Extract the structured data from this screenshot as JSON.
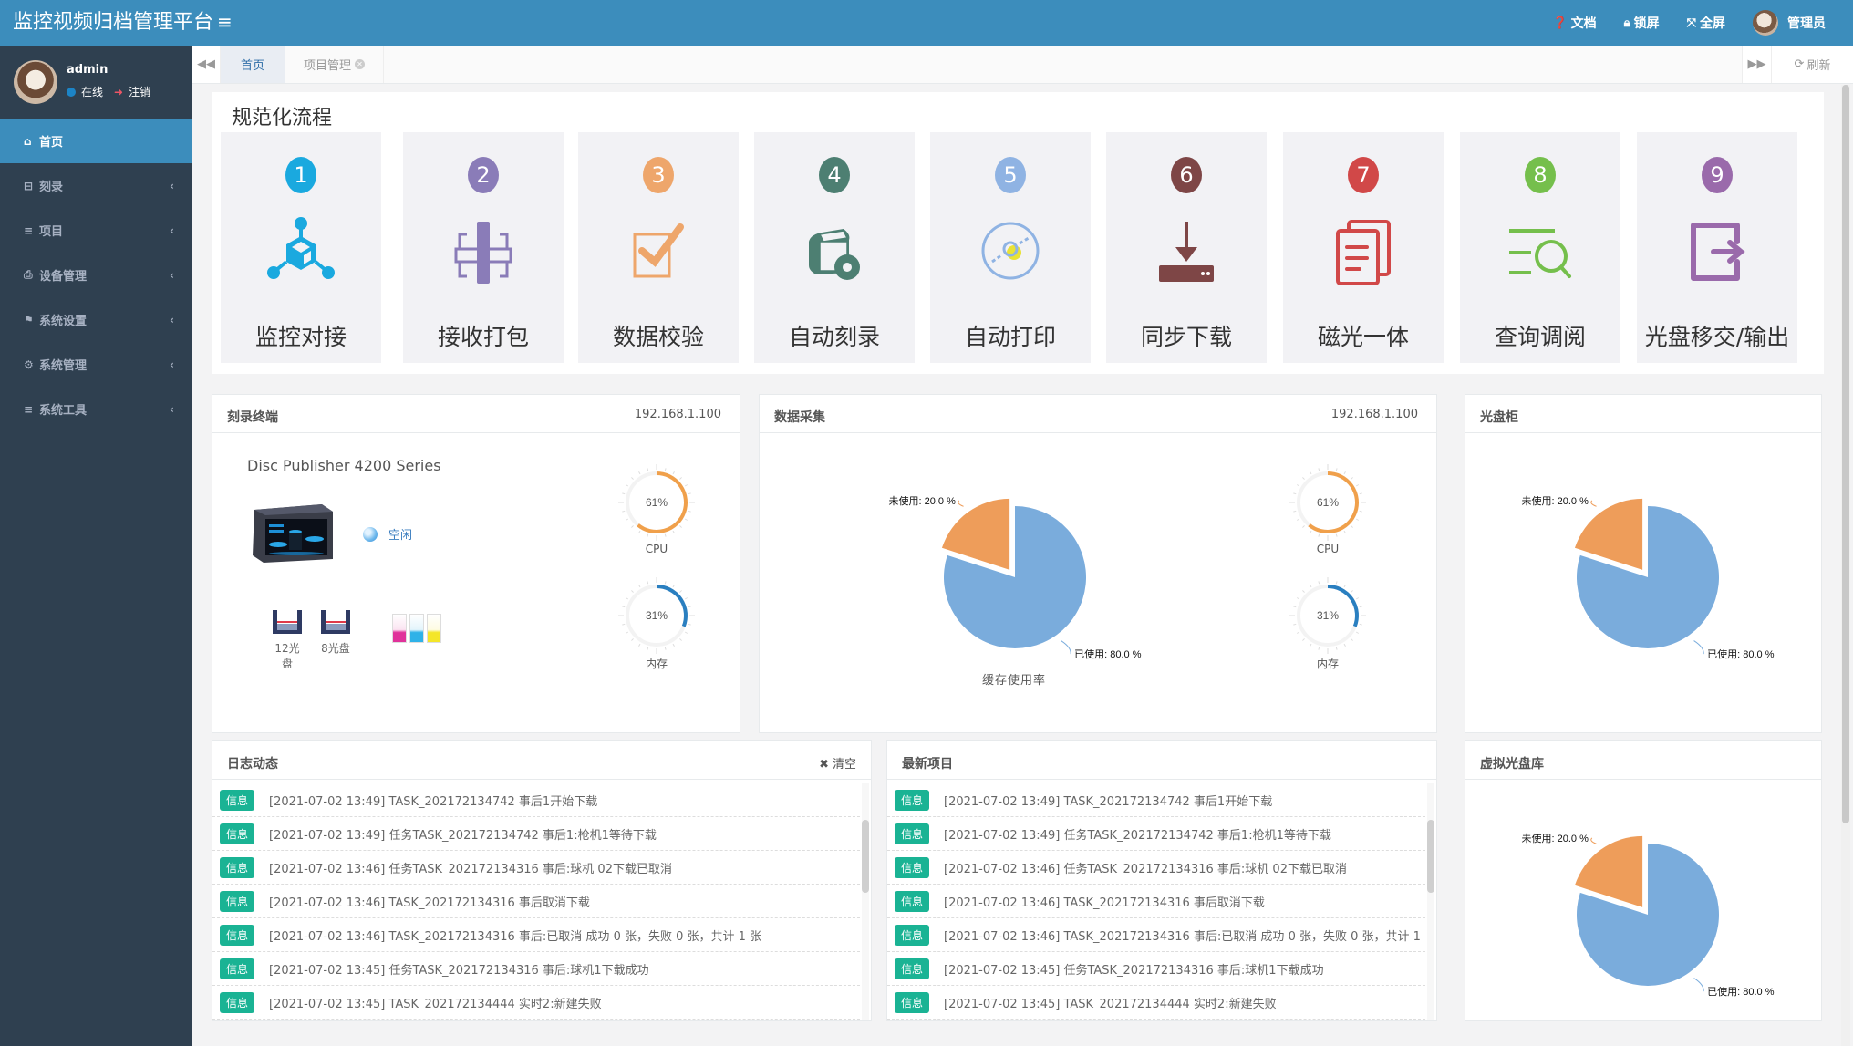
{
  "header": {
    "title": "监控视频归档管理平台",
    "menu_toggle": "≡",
    "docs": "文档",
    "lock": "锁屏",
    "fullscreen": "全屏",
    "user": "管理员"
  },
  "sidebar": {
    "user": {
      "name": "admin",
      "status": "在线",
      "logout": "注销"
    },
    "items": [
      {
        "label": "首页",
        "icon": "home-icon",
        "glyph": "⌂"
      },
      {
        "label": "刻录",
        "icon": "hdd-icon",
        "glyph": "⊟"
      },
      {
        "label": "项目",
        "icon": "list-icon",
        "glyph": "≡"
      },
      {
        "label": "设备管理",
        "icon": "print-icon",
        "glyph": "⎙"
      },
      {
        "label": "系统设置",
        "icon": "flag-icon",
        "glyph": "⚑"
      },
      {
        "label": "系统管理",
        "icon": "gear-icon",
        "glyph": "⚙"
      },
      {
        "label": "系统工具",
        "icon": "list-icon",
        "glyph": "≡"
      }
    ],
    "chevron": "‹"
  },
  "tabs": {
    "nav_left": "◀◀",
    "items": [
      {
        "label": "首页"
      },
      {
        "label": "项目管理"
      }
    ],
    "nav_right": "▶▶",
    "refresh": "刷新"
  },
  "process": {
    "title": "规范化流程",
    "steps": [
      {
        "num": "1",
        "label": "监控对接",
        "color": "#1aa9df",
        "icon": "network-cube-icon"
      },
      {
        "num": "2",
        "label": "接收打包",
        "color": "#8a7cb8",
        "icon": "package-icon"
      },
      {
        "num": "3",
        "label": "数据校验",
        "color": "#eea66b",
        "icon": "checkbox-icon"
      },
      {
        "num": "4",
        "label": "自动刻录",
        "color": "#4d7f72",
        "icon": "disc-burner-icon"
      },
      {
        "num": "5",
        "label": "自动打印",
        "color": "#8fb3e3",
        "icon": "disc-print-icon"
      },
      {
        "num": "6",
        "label": "同步下载",
        "color": "#7e4646",
        "icon": "download-icon"
      },
      {
        "num": "7",
        "label": "磁光一体",
        "color": "#d14848",
        "icon": "documents-icon"
      },
      {
        "num": "8",
        "label": "查询调阅",
        "color": "#75bf4c",
        "icon": "search-list-icon"
      },
      {
        "num": "9",
        "label": "光盘移交/输出",
        "color": "#9a6aab",
        "icon": "export-icon"
      }
    ]
  },
  "burn": {
    "title": "刻录终端",
    "ip": "192.168.1.100",
    "device": "Disc Publisher 4200 Series",
    "status": "空闲",
    "trays": [
      {
        "label": "12光盘"
      },
      {
        "label": "8光盘"
      }
    ],
    "inks": [
      "#e0329a",
      "#2fb2e8",
      "#f4e629"
    ],
    "cpu": {
      "label": "CPU",
      "value": 61,
      "text": "61%",
      "color": "#f0a04b"
    },
    "mem": {
      "label": "内存",
      "value": 31,
      "text": "31%",
      "color": "#2a7fc0"
    }
  },
  "collect": {
    "title": "数据采集",
    "ip": "192.168.1.100",
    "cpu": {
      "label": "CPU",
      "value": 61,
      "text": "61%",
      "color": "#f0a04b"
    },
    "mem": {
      "label": "内存",
      "value": 31,
      "text": "31%",
      "color": "#2a7fc0"
    }
  },
  "cabinet": {
    "title": "光盘柜"
  },
  "virtual": {
    "title": "虚拟光盘库"
  },
  "log": {
    "title": "日志动态",
    "clear": "清空",
    "badge": "信息",
    "rows": [
      "[2021-07-02 13:49] TASK_202172134742 事后1开始下载",
      "[2021-07-02 13:49] 任务TASK_202172134742 事后1:枪机1等待下载",
      "[2021-07-02 13:46] 任务TASK_202172134316 事后:球机 02下载已取消",
      "[2021-07-02 13:46] TASK_202172134316 事后取消下载",
      "[2021-07-02 13:46] TASK_202172134316 事后:已取消 成功 0 张，失败 0 张，共计 1 张",
      "[2021-07-02 13:45] 任务TASK_202172134316 事后:球机1下载成功",
      "[2021-07-02 13:45] TASK_202172134444 实时2:新建失败"
    ]
  },
  "projects": {
    "title": "最新项目",
    "badge": "信息",
    "rows": [
      "[2021-07-02 13:49] TASK_202172134742 事后1开始下载",
      "[2021-07-02 13:49] 任务TASK_202172134742 事后1:枪机1等待下载",
      "[2021-07-02 13:46] 任务TASK_202172134316 事后:球机 02下载已取消",
      "[2021-07-02 13:46] TASK_202172134316 事后取消下载",
      "[2021-07-02 13:46] TASK_202172134316 事后:已取消 成功 0 张，失败 0 张，共计 1",
      "[2021-07-02 13:45] 任务TASK_202172134316 事后:球机1下载成功",
      "[2021-07-02 13:45] TASK_202172134444 实时2:新建失败"
    ]
  },
  "chart_data": [
    {
      "type": "pie",
      "title": "缓存使用率",
      "panel": "数据采集",
      "slices": [
        {
          "label": "已使用",
          "value": 80.0,
          "display": "已使用: 80.0 %",
          "color": "#7aacdc"
        },
        {
          "label": "未使用",
          "value": 20.0,
          "display": "未使用: 20.0 %",
          "color": "#ee9d5a",
          "exploded": true
        }
      ]
    },
    {
      "type": "pie",
      "title": "",
      "panel": "光盘柜",
      "slices": [
        {
          "label": "已使用",
          "value": 80.0,
          "display": "已使用: 80.0 %",
          "color": "#7aacdc"
        },
        {
          "label": "未使用",
          "value": 20.0,
          "display": "未使用: 20.0 %",
          "color": "#ee9d5a",
          "exploded": true
        }
      ]
    },
    {
      "type": "pie",
      "title": "",
      "panel": "虚拟光盘库",
      "slices": [
        {
          "label": "已使用",
          "value": 80.0,
          "display": "已使用: 80.0 %",
          "color": "#7aacdc"
        },
        {
          "label": "未使用",
          "value": 20.0,
          "display": "未使用: 20.0 %",
          "color": "#ee9d5a",
          "exploded": true
        }
      ]
    }
  ]
}
